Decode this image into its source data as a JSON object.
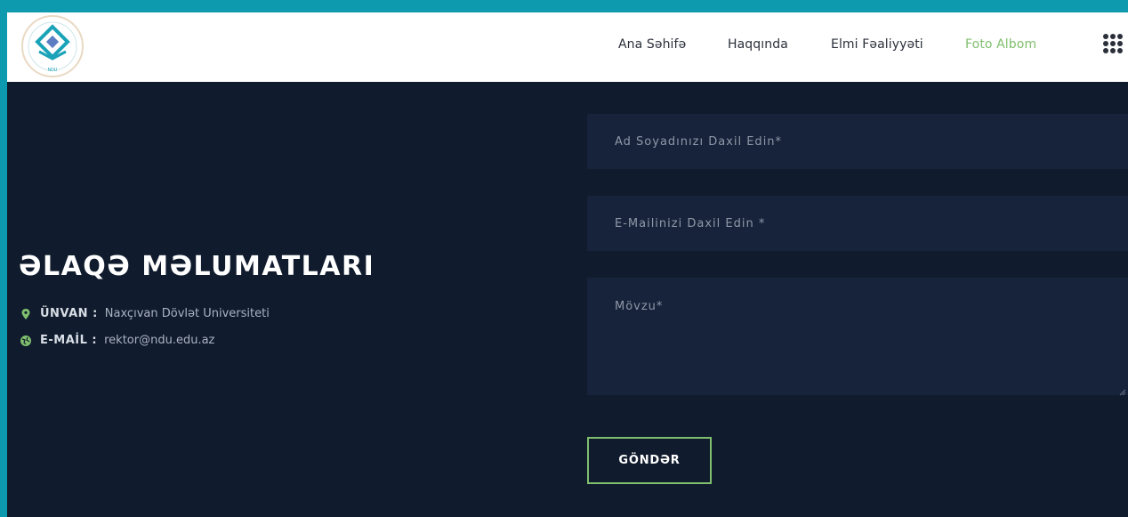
{
  "header": {
    "nav": [
      {
        "label": "Ana Səhifə",
        "active": false
      },
      {
        "label": "Haqqında",
        "active": false
      },
      {
        "label": "Elmi Fəaliyyəti",
        "active": false
      },
      {
        "label": "Foto Albom",
        "active": true
      }
    ],
    "menu_icon": "grid-menu-icon",
    "logo_icon": "university-logo"
  },
  "contact": {
    "title": "ƏLAQƏ MƏLUMATLARI",
    "address_label": "ÜNVAN :",
    "address_value": "Naxçıvan Dövlət Universiteti",
    "address_icon": "map-pin-icon",
    "email_label": "E-MAİL :",
    "email_value": "rektor@ndu.edu.az",
    "email_icon": "globe-icon"
  },
  "form": {
    "name_placeholder": "Ad Soyadınızı Daxil Edin*",
    "email_placeholder": "E-Mailinizi Daxil Edin *",
    "subject_placeholder": "Mövzu*",
    "submit_label": "GÖNDƏR"
  },
  "colors": {
    "accent": "#7fbf6e",
    "frame": "#0e9aae",
    "background": "#101b2d",
    "field": "#17233a"
  }
}
